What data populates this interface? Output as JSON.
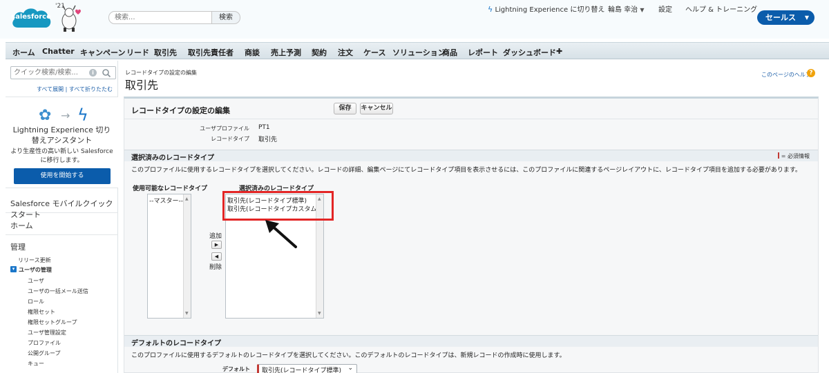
{
  "header": {
    "logo_text": "salesforce",
    "mascot_year": "'21",
    "search_placeholder": "検索...",
    "search_button": "検索",
    "switch_lightning": "Lightning Experience に切り替え",
    "user_name": "輪島 幸治",
    "setup": "設定",
    "help_training": "ヘルプ & トレーニング",
    "app_menu": "セールス"
  },
  "tabs": [
    "ホーム",
    "Chatter",
    "キャンペーン",
    "リード",
    "取引先",
    "取引先責任者",
    "商談",
    "売上予測",
    "契約",
    "注文",
    "ケース",
    "ソリューション",
    "商品",
    "レポート",
    "ダッシュボード",
    "✚"
  ],
  "sidebar": {
    "quick_find_placeholder": "クイック検索/検索...",
    "info_icon": "i",
    "expand_collapse": "すべて展開 | すべて折りたたむ",
    "assistant": {
      "title": "Lightning Experience 切り替えアシスタント",
      "description": "より生産性の高い新しい Salesforce に移行します。",
      "button": "使用を開始する"
    },
    "mobile_quickstart": "Salesforce モバイルクイックスタート",
    "home": "ホーム",
    "admin": "管理",
    "release_updates": "リリース更新",
    "user_mgmt": "ユーザの管理",
    "user_mgmt_toggle": "▾",
    "links": [
      "ユーザ",
      "ユーザの一括メール送信",
      "ロール",
      "権限セット",
      "権限セットグループ",
      "ユーザ管理設定",
      "プロファイル",
      "公開グループ",
      "キュー"
    ]
  },
  "page": {
    "breadcrumb": "レコードタイプの設定の編集",
    "title": "取引先",
    "help_link": "このページのヘルプ",
    "help_icon": "?"
  },
  "panel": {
    "title": "レコードタイプの設定の編集",
    "save": "保存",
    "cancel": "キャンセル",
    "profile_label": "ユーザプロファイル",
    "profile_value": "PT1",
    "record_type_label": "レコードタイプ",
    "record_type_value": "取引先"
  },
  "selected_section": {
    "heading": "選択済みのレコードタイプ",
    "required_info": "= 必須情報",
    "description": "このプロファイルに使用するレコードタイプを選択してください。レコードの詳細、編集ページにてレコードタイプ項目を表示させるには、このプロファイルに関連するページレイアウトに、レコードタイプ項目を追加する必要があります。",
    "available_header": "使用可能なレコードタイプ",
    "selected_header": "選択済みのレコードタイプ",
    "available_items": [
      "--マスター--"
    ],
    "selected_items": [
      "取引先(レコードタイプ標準)",
      "取引先(レコードタイプカスタム)"
    ],
    "add_label": "追加",
    "remove_label": "削除",
    "add_arrow": "▶",
    "remove_arrow": "◀"
  },
  "default_section": {
    "heading": "デフォルトのレコードタイプ",
    "description": "このプロファイルに使用するデフォルトのレコードタイプを選択してください。このデフォルトのレコードタイプは、新規レコードの作成時に使用します。",
    "default_label": "デフォルト",
    "default_value": "取引先(レコードタイプ標準)"
  },
  "colors": {
    "brand_blue": "#0b5cab",
    "highlight_red": "#e32525",
    "required_red": "#c23934"
  }
}
